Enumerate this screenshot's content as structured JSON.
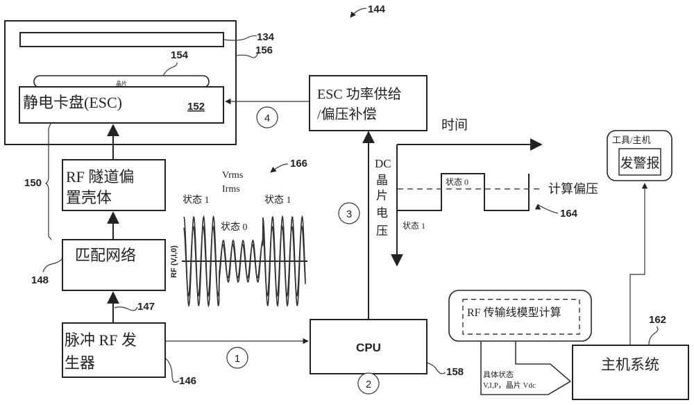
{
  "figure": {
    "ref_main": "144",
    "chamber": {
      "ref_chamber": "156",
      "ref_upper_electrode": "134",
      "wafer": {
        "label": "晶片",
        "ref": "154"
      },
      "esc": {
        "label": "静电卡盘(ESC)",
        "ref": "152"
      }
    },
    "rf_tunnel": {
      "line1": "RF 隧道偏",
      "line2": "置壳体"
    },
    "ref_transmission_path": "150",
    "match_network": {
      "label": "匹配网络",
      "ref": "148"
    },
    "ref_rf_cable": "147",
    "pulsed_rf_generator": {
      "line1": "脉冲 RF 发",
      "line2": "生器",
      "ref": "146"
    },
    "esc_power_supply": {
      "line1": "ESC 功率供给",
      "line2": "/偏压补偿"
    },
    "cpu": {
      "label": "CPU",
      "ref": "158"
    },
    "steps": [
      "1",
      "2",
      "3",
      "4"
    ],
    "rf_waveform": {
      "ref": "166",
      "label_vrms": "Vrms",
      "label_irms": "Irms",
      "state1_left": "状态 1",
      "state1_right": "状态 1",
      "state0": "状态 0",
      "y_axis_label": "RF (V,I,0)"
    },
    "dc_plot": {
      "ref": "164",
      "x_axis_label": "时间",
      "y_axis_label": [
        "DC",
        "晶",
        "片",
        "电",
        "压"
      ],
      "state0": "状态 0",
      "state1": "状态 1",
      "computed_bias": "计算偏压"
    },
    "tool_host": {
      "title": "工具/主机",
      "alarm": "发警报"
    },
    "rf_model": {
      "label": "RF 传输线模型计算"
    },
    "callout": {
      "line1": "具体状态",
      "line2": "V,I,P，晶片 Vdc"
    },
    "host_system": {
      "label": "主机系统",
      "ref": "162"
    }
  }
}
